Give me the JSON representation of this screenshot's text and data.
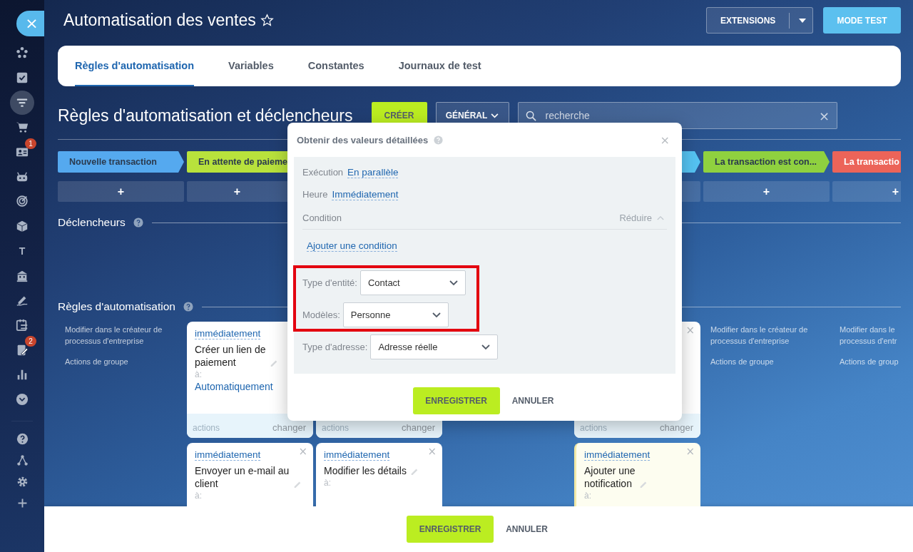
{
  "sidebar": {
    "close": "×",
    "items": [
      {
        "selected": false
      },
      {
        "selected": false
      },
      {
        "selected": true
      },
      {
        "selected": false
      },
      {
        "selected": false,
        "badge": "1"
      },
      {
        "selected": false
      },
      {
        "selected": false
      },
      {
        "selected": false
      },
      {
        "selected": false,
        "letter": "T"
      },
      {
        "selected": false
      },
      {
        "selected": false
      },
      {
        "selected": false
      },
      {
        "selected": false,
        "badge": "2"
      },
      {
        "selected": false
      },
      {
        "selected": false
      }
    ]
  },
  "header": {
    "title": "Automatisation des ventes",
    "starred": false,
    "buttons": [
      {
        "kind": "split",
        "label": "EXTENSIONS"
      },
      {
        "kind": "primary",
        "label": "MODE TEST"
      }
    ]
  },
  "tabs": [
    {
      "label": "Règles d'automatisation",
      "selected": true
    },
    {
      "label": "Variables",
      "selected": false
    },
    {
      "label": "Constantes",
      "selected": false
    },
    {
      "label": "Journaux de test",
      "selected": false
    }
  ],
  "toolbar": {
    "heading": "Règles d'automatisation et déclencheurs",
    "create_button": "CRÉER",
    "filter_button": "GÉNÉRAL",
    "search": {
      "placeholder": "recherche",
      "clear": "×"
    }
  },
  "stages": [
    {
      "label": "Nouvelle transaction",
      "color": "#55a9ef",
      "add": "+"
    },
    {
      "label": "En attente de paieme",
      "color": "#b8e23c",
      "add": "+"
    },
    {
      "color": "#55c3f2"
    },
    {
      "label": "La transaction est con...",
      "color": "#8fd13f",
      "add": "+"
    },
    {
      "label": "La transactio",
      "color": "#ec6459",
      "add": "+"
    }
  ],
  "triggers": {
    "heading": "Déclencheurs"
  },
  "rules": {
    "heading": "Règles d'automatisation",
    "columns": [
      {
        "items": [
          {
            "kind": "group",
            "links": [
              [
                "Modifier dans le créateur de",
                "processus d'entreprise"
              ],
              [
                "Actions de groupe"
              ]
            ]
          }
        ]
      },
      {
        "items": [
          {
            "kind": "card",
            "color": "#ffffff",
            "timing": "immédiatement",
            "title": "Créer un lien de paiement",
            "to_label": "à:",
            "target": "Automatiquement",
            "footer": [
              "actions",
              "changer"
            ]
          },
          {
            "kind": "card",
            "color": "#ffffff",
            "close": "×",
            "timing": "immédiatement",
            "title": "Envoyer un e-mail au client",
            "to_label": "à:"
          }
        ]
      },
      {
        "items": [
          {
            "kind": "card",
            "color": "#ffffff",
            "footer": [
              "actions",
              "changer"
            ]
          },
          {
            "kind": "card",
            "color": "#ffffff",
            "close": "×",
            "timing": "immédiatement",
            "title": "Modifier les détails",
            "to_label": "à:"
          }
        ]
      },
      {
        "items": [
          {
            "kind": "card",
            "color": "#ffffff",
            "close": "×",
            "footer": [
              "actions",
              "changer"
            ]
          },
          {
            "kind": "card",
            "color": "#fdfdf0",
            "close": "×",
            "timing": "immédiatement",
            "title": "Ajouter une notification",
            "to_label": "à:"
          }
        ]
      },
      {
        "items": [
          {
            "kind": "group",
            "links": [
              [
                "Modifier dans le créateur de",
                "processus d'entreprise"
              ],
              [
                "Actions de groupe"
              ]
            ]
          }
        ]
      },
      {
        "items": [
          {
            "kind": "group",
            "links": [
              [
                "Modifier dans le",
                "processus d'entr"
              ],
              [
                "Actions de group"
              ]
            ]
          }
        ]
      }
    ]
  },
  "dialog": {
    "title": "Obtenir des valeurs détaillées",
    "close": "×",
    "fields": [
      {
        "kind": "link_row",
        "label": "Exécution",
        "value": "En parallèle",
        "highlighted": false
      },
      {
        "kind": "link_row",
        "label": "Heure",
        "value": "Immédiatement",
        "highlighted": false
      },
      {
        "kind": "section",
        "label": "Condition",
        "action": "Réduire",
        "highlighted": false
      },
      {
        "kind": "link",
        "value": "Ajouter une condition",
        "highlighted": false
      },
      {
        "kind": "select",
        "label": "Type d'entité:",
        "value": "Contact",
        "highlighted": true
      },
      {
        "kind": "select",
        "label": "Modèles:",
        "value": "Personne",
        "highlighted": true
      },
      {
        "kind": "select",
        "label": "Type d'adresse:",
        "value": "Adresse réelle",
        "highlighted": false
      }
    ],
    "save": "ENREGISTRER",
    "cancel": "ANNULER"
  },
  "footer": {
    "save": "ENREGISTRER",
    "cancel": "ANNULER"
  }
}
